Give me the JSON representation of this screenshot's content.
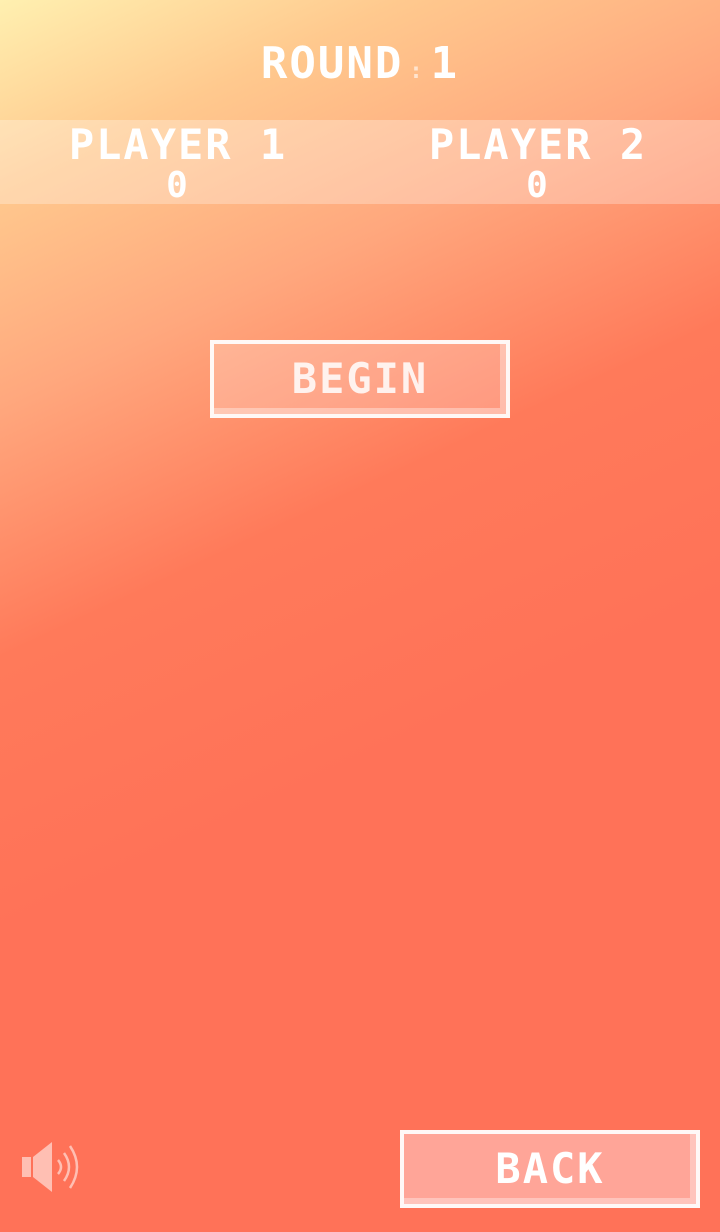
{
  "header": {
    "round_label": "ROUND",
    "round_separator": ":",
    "round_number": "1"
  },
  "scoreboard": {
    "player1": {
      "name": "PLAYER 1",
      "score": "0"
    },
    "player2": {
      "name": "PLAYER 2",
      "score": "0"
    }
  },
  "buttons": {
    "begin_label": "BEGIN",
    "back_label": "BACK"
  },
  "icons": {
    "sound": "speaker-icon"
  },
  "colors": {
    "background_top": "#fff0b0",
    "background_bottom": "#ff7258",
    "text": "#ffffff",
    "back_button_fill": "#ffa598"
  }
}
